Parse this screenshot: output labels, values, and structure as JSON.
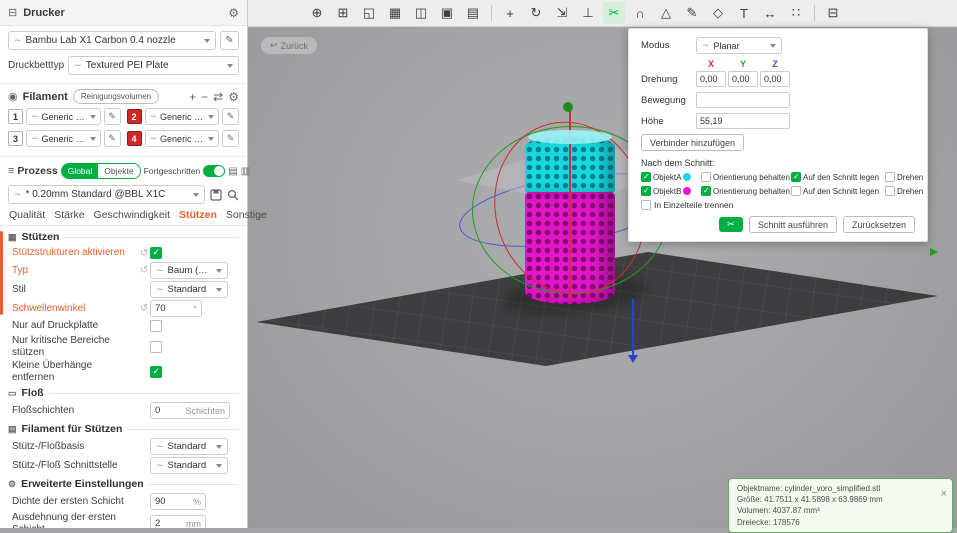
{
  "glyphs": {
    "gear": "⚙",
    "edit": "✎",
    "plus": "+",
    "minus": "−",
    "swap": "⇄",
    "revert": "↺",
    "tilde": "∼",
    "close": "×",
    "back": "↩",
    "process": "≡",
    "list_a": "▤",
    "list_b": "▥",
    "filament": "◉",
    "printer": "⊟",
    "scissors": "✂",
    "sec_support": "▦",
    "sec_raft": "▭",
    "sec_filament": "▤",
    "sec_advanced": "⚙"
  },
  "colors": {
    "accent_green": "#00ae42",
    "accent_orange": "#e8612a",
    "object_cyan": "#17d9e2",
    "object_magenta": "#e316ca"
  },
  "toolbar": {
    "icons": [
      {
        "name": "add-model",
        "glyph": "⊕"
      },
      {
        "name": "add-plate",
        "glyph": "⊞"
      },
      {
        "name": "auto-orient",
        "glyph": "◱"
      },
      {
        "name": "arrange",
        "glyph": "▦"
      },
      {
        "name": "split-to-objects",
        "glyph": "◫"
      },
      {
        "name": "split-to-parts",
        "glyph": "▣"
      },
      {
        "name": "variable-layer-height",
        "glyph": "▤"
      },
      {
        "separator": true
      },
      {
        "name": "move-tool",
        "glyph": "+"
      },
      {
        "name": "rotate-tool",
        "glyph": "↻"
      },
      {
        "name": "scale-tool",
        "glyph": "⇲"
      },
      {
        "name": "place-on-face-tool",
        "glyph": "⊥"
      },
      {
        "name": "cut-tool",
        "glyph": "✂",
        "active": true
      },
      {
        "name": "mesh-boolean-tool",
        "glyph": "∩"
      },
      {
        "name": "support-painting-tool",
        "glyph": "△"
      },
      {
        "name": "color-painting-tool",
        "glyph": "✎"
      },
      {
        "name": "seam-painting-tool",
        "glyph": "◇"
      },
      {
        "name": "text-tool",
        "glyph": "T"
      },
      {
        "name": "measure-tool",
        "glyph": "↔"
      },
      {
        "name": "assembly-view",
        "glyph": "∷"
      },
      {
        "separator": true
      },
      {
        "name": "plate-settings",
        "glyph": "⊟"
      }
    ]
  },
  "sidebar": {
    "printer": {
      "title": "Drucker",
      "name": "Bambu Lab X1 Carbon 0.4 nozzle",
      "bed_label": "Druckbetttyp",
      "bed_value": "Textured PEI Plate"
    },
    "filament": {
      "title": "Filament",
      "flush_label": "Reinigungsvolumen",
      "slots": [
        {
          "num": "1",
          "name": "Generic PLA",
          "bg": "#ffffff",
          "fg": "#333333"
        },
        {
          "num": "2",
          "name": "Generic PLA",
          "bg": "#d02727",
          "fg": "#ffffff"
        },
        {
          "num": "3",
          "name": "Generic PLA",
          "bg": "#ffffff",
          "fg": "#333333"
        },
        {
          "num": "4",
          "name": "Generic PLA",
          "bg": "#d02727",
          "fg": "#ffffff"
        }
      ]
    },
    "process": {
      "title": "Prozess",
      "global_label": "Global",
      "objects_label": "Objekte",
      "advanced_label": "Fortgeschritten",
      "preset": "* 0.20mm Standard @BBL X1C"
    },
    "tabs": [
      "Qualität",
      "Stärke",
      "Geschwindigkeit",
      "Stützen",
      "Sonstige"
    ],
    "support": {
      "title": "Stützen",
      "enable_label": "Stützstrukturen aktivieren",
      "enable_checked": true,
      "type_label": "Typ",
      "type_value": "Baum (auto)",
      "style_label": "Stil",
      "style_value": "Standard",
      "threshold_label": "Schwellenwinkel",
      "threshold_value": "70",
      "threshold_unit": "°",
      "plate_only_label": "Nur auf Druckplatte",
      "plate_only_checked": false,
      "critical_label": "Nur kritische Bereiche stützen",
      "critical_checked": false,
      "overhang_label": "Kleine Überhänge entfernen",
      "overhang_checked": true
    },
    "raft": {
      "title": "Floß",
      "layers_label": "Floßschichten",
      "layers_value": "0",
      "layers_unit": "Schichten"
    },
    "support_filament": {
      "title": "Filament für Stützen",
      "base_label": "Stütz-/Floßbasis",
      "base_value": "Standard",
      "interface_label": "Stütz-/Floß Schnittstelle",
      "interface_value": "Standard"
    },
    "advanced": {
      "title": "Erweiterte Einstellungen",
      "density_label": "Dichte der ersten Schicht",
      "density_value": "90",
      "density_unit": "%",
      "expansion_label": "Ausdehnung der ersten Schicht",
      "expansion_value": "2",
      "expansion_unit": "mm"
    }
  },
  "viewport": {
    "back_label": "Zurück"
  },
  "cut": {
    "mode_label": "Modus",
    "mode_value": "Planar",
    "axes": [
      "X",
      "Y",
      "Z"
    ],
    "axis_colors": [
      "#d62b2b",
      "#2ba32b",
      "#2b50d6"
    ],
    "rotation_label": "Drehung",
    "rotation": [
      "0,00",
      "0,00",
      "0,00"
    ],
    "movement_label": "Bewegung",
    "movement_value": "",
    "height_label": "Höhe",
    "height_value": "55,19",
    "add_connector_label": "Verbinder hinzufügen",
    "after_cut_label": "Nach dem Schnitt:",
    "keep_label": "Orientierung behalten",
    "place_label": "Auf den Schnitt legen",
    "flip_label": "Drehen",
    "objA": {
      "label": "ObjektA",
      "color": "#1bd9e3",
      "checked": true,
      "keep": false,
      "place": true,
      "flip": false
    },
    "objB": {
      "label": "ObjektB",
      "color": "#e61ad2",
      "checked": true,
      "keep": true,
      "place": false,
      "flip": false
    },
    "separate_label": "In Einzelteile trennen",
    "separate_checked": false,
    "perform_label": "Schnitt ausführen",
    "reset_label": "Zurücksetzen"
  },
  "infobox": {
    "line1": "Objektname: cylinder_voro_simplified.stl",
    "line2": "Größe: 41.7511 x 41.5898 x 63.9869 mm",
    "line3": "Volumen: 4037.87 mm³",
    "line4": "Dreiecke: 178576"
  }
}
